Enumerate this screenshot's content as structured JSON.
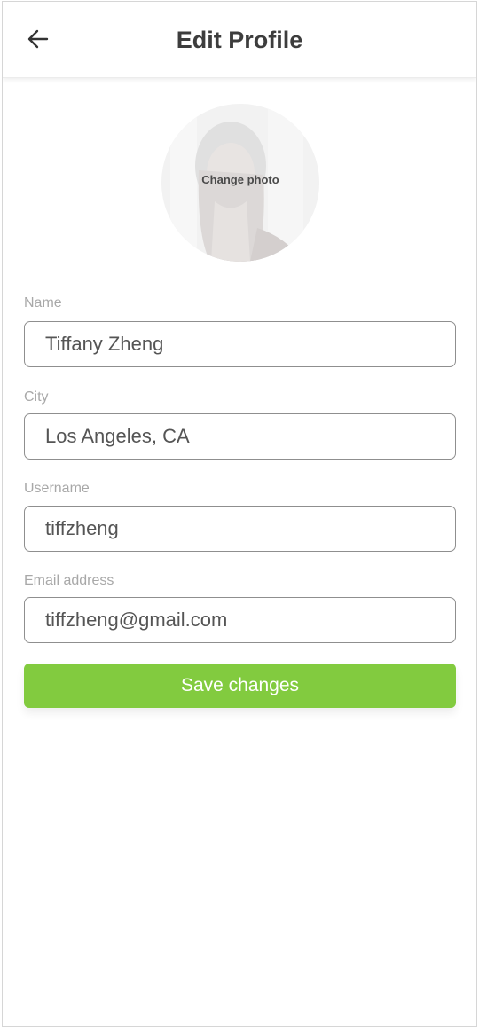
{
  "header": {
    "title": "Edit Profile",
    "back_icon": "arrow-left-icon"
  },
  "avatar": {
    "change_photo_label": "Change photo"
  },
  "form": {
    "name": {
      "label": "Name",
      "value": "Tiffany Zheng"
    },
    "city": {
      "label": "City",
      "value": "Los Angeles, CA"
    },
    "username": {
      "label": "Username",
      "value": "tiffzheng"
    },
    "email": {
      "label": "Email address",
      "value": "tiffzheng@gmail.com"
    }
  },
  "actions": {
    "save_label": "Save changes"
  },
  "colors": {
    "accent": "#82cb3f",
    "title_text": "#3d3d3d",
    "label_text": "#a8a8a8",
    "input_border": "#8f8f8f"
  }
}
